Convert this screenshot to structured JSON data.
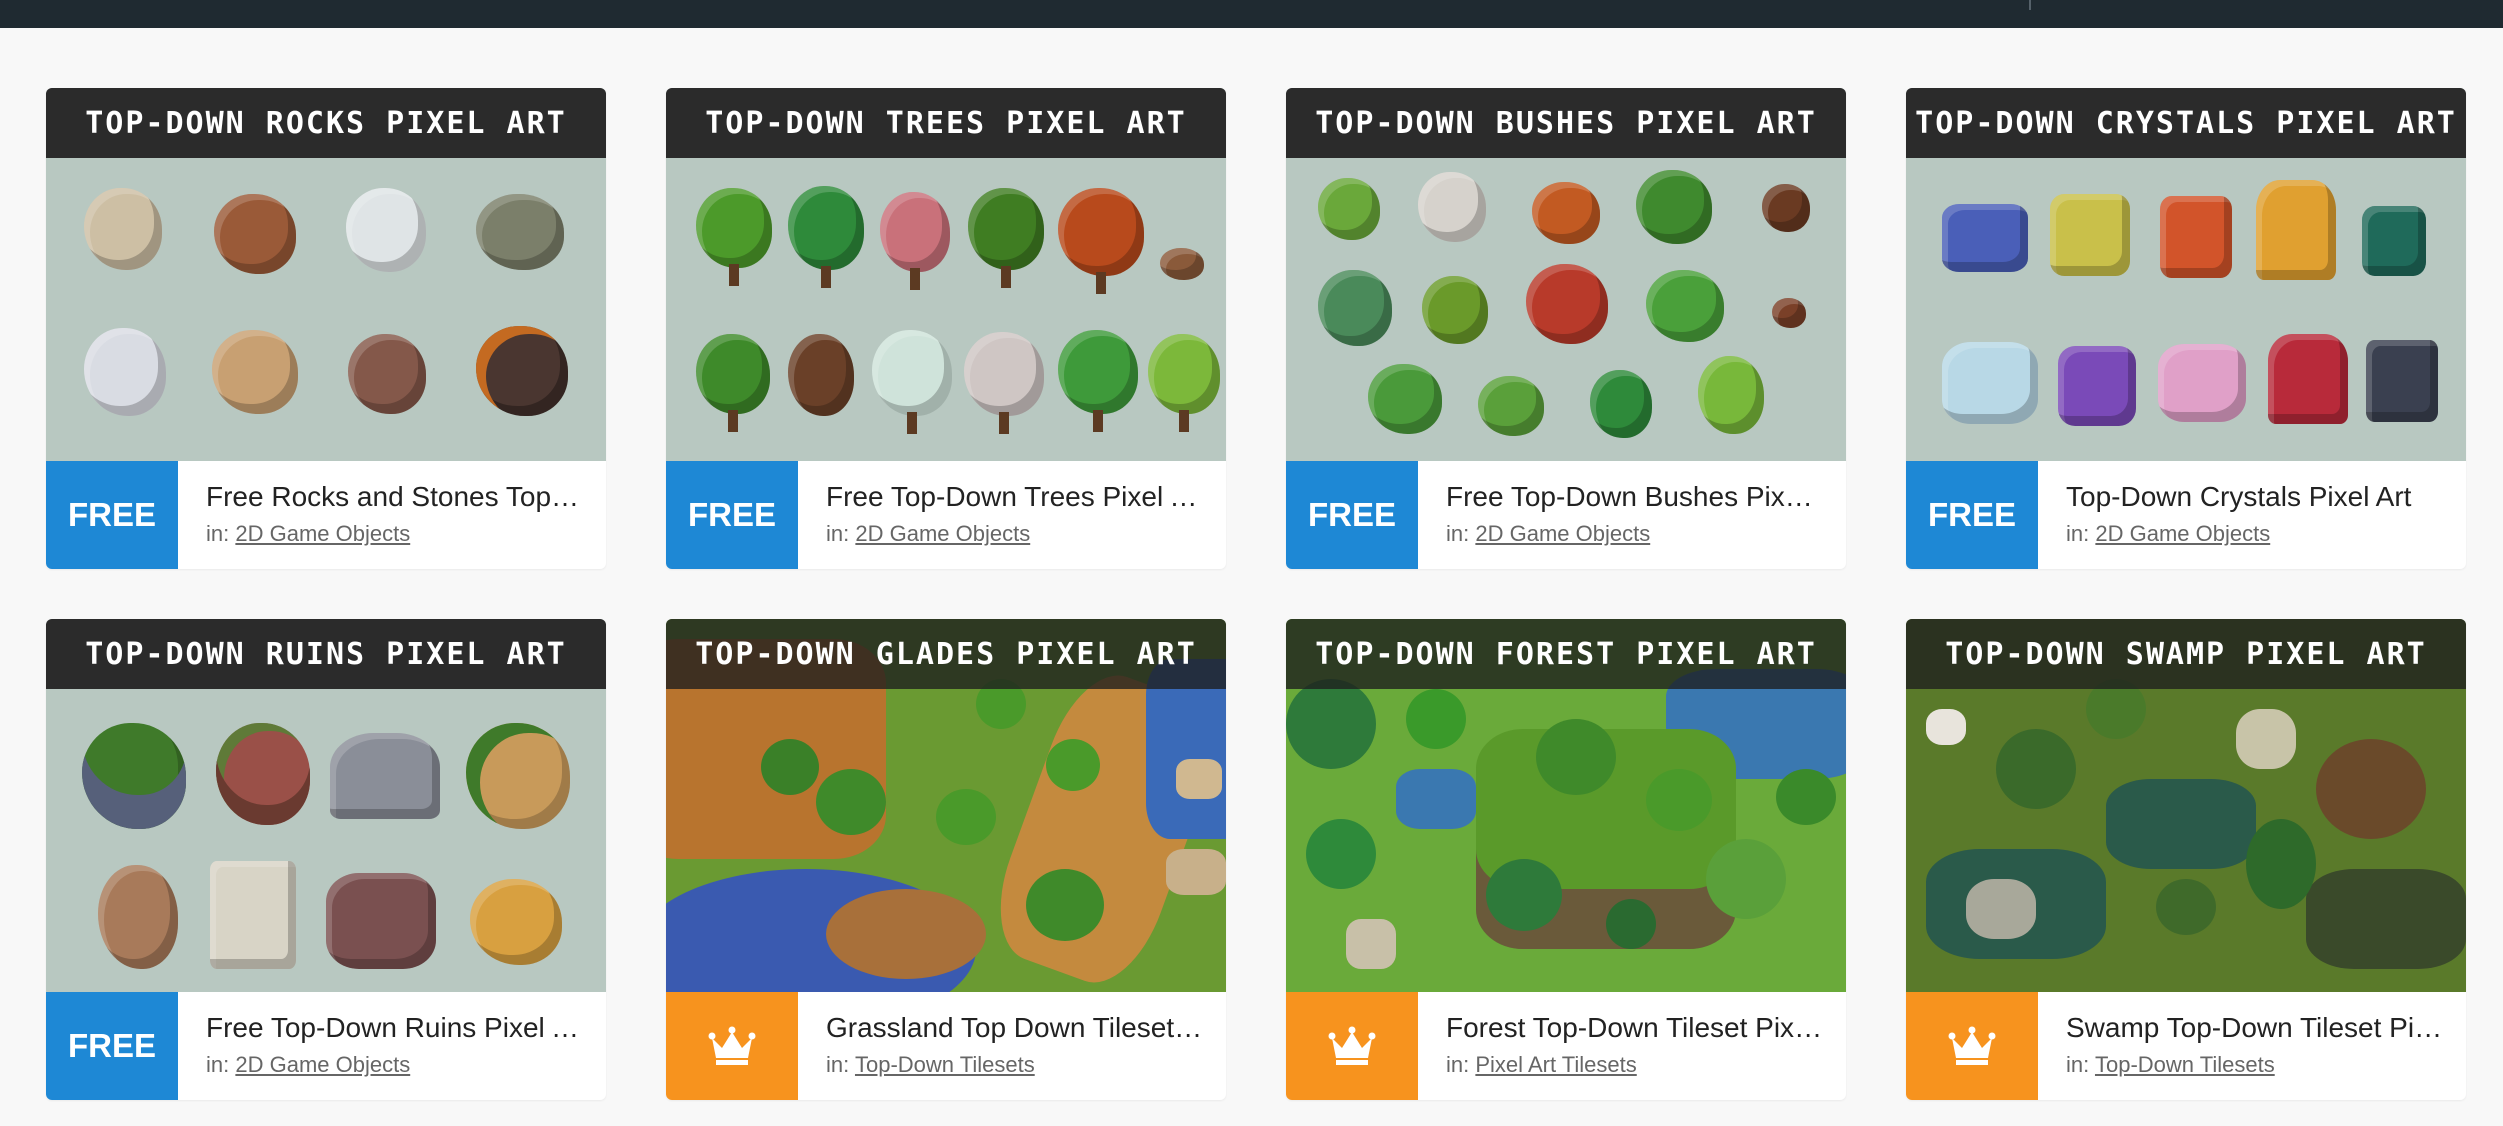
{
  "cards": [
    {
      "banner": "TOP-DOWN ROCKS PIXEL ART",
      "badge": "FREE",
      "title": "Free Rocks and Stones Top-Down Pixel Art",
      "category_prefix": "in:",
      "category": "2D Game Objects"
    },
    {
      "banner": "TOP-DOWN TREES PIXEL ART",
      "badge": "FREE",
      "title": "Free Top-Down Trees Pixel Art",
      "category_prefix": "in:",
      "category": "2D Game Objects"
    },
    {
      "banner": "TOP-DOWN BUSHES PIXEL ART",
      "badge": "FREE",
      "title": "Free Top-Down Bushes Pixel Art",
      "category_prefix": "in:",
      "category": "2D Game Objects"
    },
    {
      "banner": "TOP-DOWN CRYSTALS PIXEL ART",
      "badge": "FREE",
      "title": "Top-Down Crystals Pixel Art",
      "category_prefix": "in:",
      "category": "2D Game Objects"
    },
    {
      "banner": "TOP-DOWN RUINS PIXEL ART",
      "badge": "FREE",
      "title": "Free Top-Down Ruins Pixel Art",
      "category_prefix": "in:",
      "category": "2D Game Objects"
    },
    {
      "banner": "TOP-DOWN GLADES PIXEL ART",
      "badge_icon": "crown-icon",
      "title": "Grassland Top Down Tileset Pixel Art",
      "category_prefix": "in:",
      "category": "Top-Down Tilesets"
    },
    {
      "banner": "TOP-DOWN FOREST PIXEL ART",
      "badge_icon": "crown-icon",
      "title": "Forest Top-Down Tileset Pixel Art",
      "category_prefix": "in:",
      "category": "Pixel Art Tilesets"
    },
    {
      "banner": "TOP-DOWN SWAMP PIXEL ART",
      "badge_icon": "crown-icon",
      "title": "Swamp Top-Down Tileset Pixel Art",
      "category_prefix": "in:",
      "category": "Top-Down Tilesets"
    }
  ],
  "colors": {
    "free_badge": "#1e88d5",
    "premium_badge": "#f7931e",
    "topbar": "#1f2a31",
    "banner": "#2b2b2b",
    "thumb_bg": "#b8c8c1"
  }
}
